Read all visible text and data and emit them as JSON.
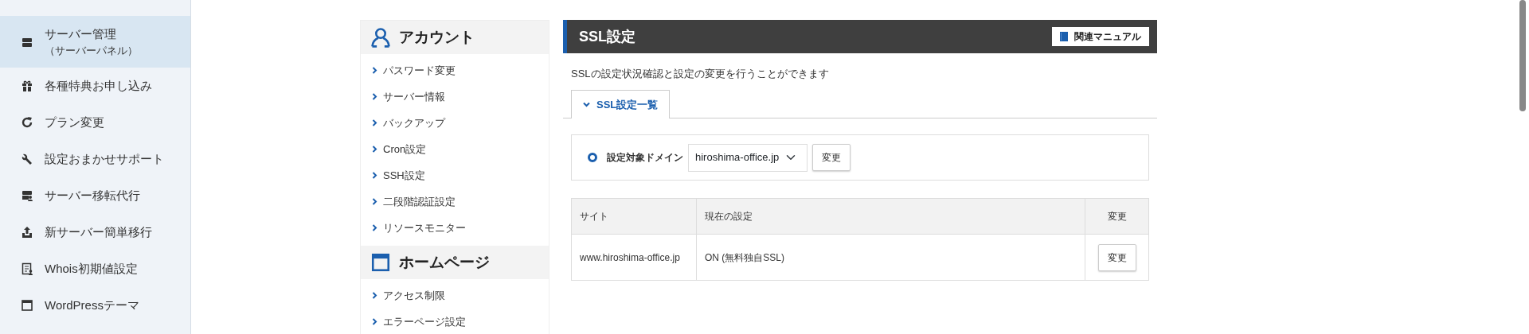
{
  "sidebar": {
    "items": [
      {
        "label": "サーバー管理",
        "sublabel": "（サーバーパネル）",
        "selected": true
      },
      {
        "label": "各種特典お申し込み",
        "selected": false
      },
      {
        "label": "プラン変更",
        "selected": false
      },
      {
        "label": "設定おまかせサポート",
        "selected": false
      },
      {
        "label": "サーバー移転代行",
        "selected": false
      },
      {
        "label": "新サーバー簡単移行",
        "selected": false
      },
      {
        "label": "Whois初期値設定",
        "selected": false
      },
      {
        "label": "WordPressテーマ",
        "selected": false
      }
    ]
  },
  "menu": [
    {
      "title": "アカウント",
      "items": [
        "パスワード変更",
        "サーバー情報",
        "バックアップ",
        "Cron設定",
        "SSH設定",
        "二段階認証設定",
        "リソースモニター"
      ]
    },
    {
      "title": "ホームページ",
      "items": [
        "アクセス制限",
        "エラーページ設定"
      ]
    }
  ],
  "main": {
    "title": "SSL設定",
    "manual_button": "関連マニュアル",
    "description": "SSLの設定状況確認と設定の変更を行うことができます",
    "tabs": [
      {
        "label": "SSL設定一覧",
        "selected": true
      }
    ],
    "domain": {
      "selected": true,
      "label": "設定対象ドメイン",
      "value": "hiroshima-office.jp",
      "button": "変更"
    },
    "table": {
      "columns": [
        "サイト",
        "現在の設定",
        "変更"
      ],
      "rows": [
        {
          "site": "www.hiroshima-office.jp",
          "setting": "ON (無料独自SSL)",
          "button": "変更"
        }
      ]
    }
  }
}
